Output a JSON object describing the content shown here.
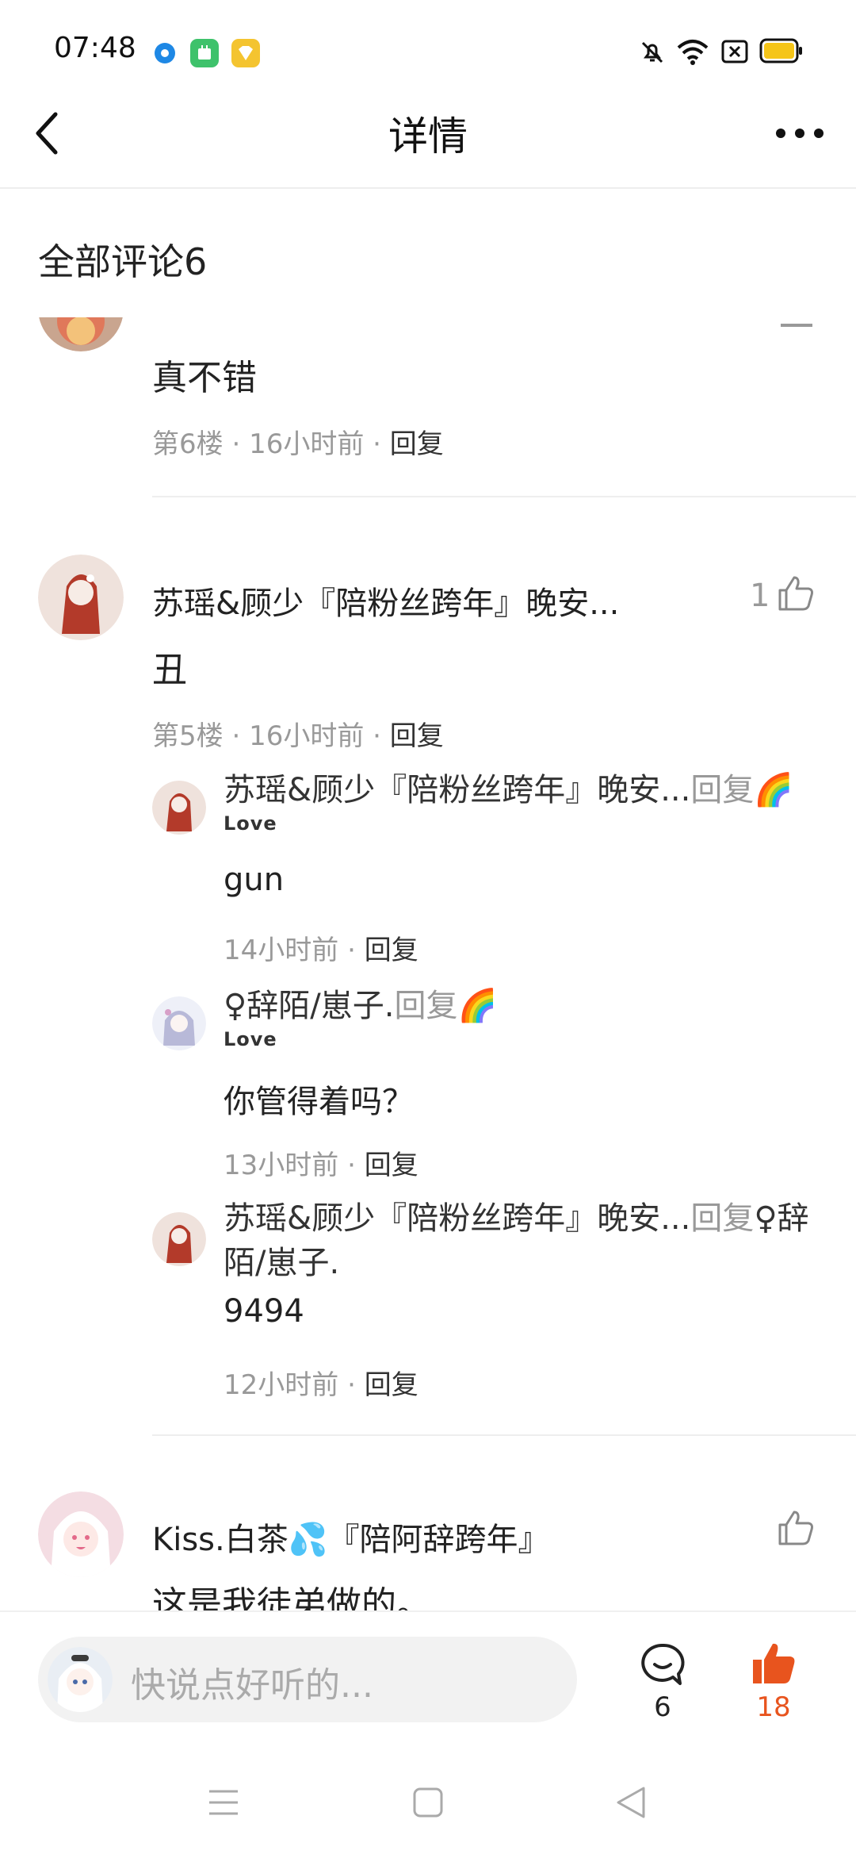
{
  "status_bar": {
    "time": "07:48"
  },
  "header": {
    "title": "详情"
  },
  "section": {
    "title": "全部评论6"
  },
  "comments": [
    {
      "body": "真不错",
      "floor": "第6楼",
      "time": "16小时前",
      "reply_label": "回复"
    },
    {
      "name": "苏瑶&顾少『陪粉丝跨年』晚安...",
      "likes": "1",
      "body": "丑",
      "floor": "第5楼",
      "time": "16小时前",
      "reply_label": "回复",
      "replies": [
        {
          "name": "苏瑶&顾少『陪粉丝跨年』晚安...",
          "reply_word": "回复",
          "target": "🌈",
          "badge": "Love",
          "body": "gun",
          "time": "14小时前",
          "reply_label": "回复"
        },
        {
          "name": "♀辞陌/崽子.",
          "reply_word": "回复",
          "target": "🌈",
          "badge": "Love",
          "body": "你管得着吗？",
          "time": "13小时前",
          "reply_label": "回复"
        },
        {
          "name": "苏瑶&顾少『陪粉丝跨年』晚安...",
          "reply_word": "回复",
          "target": "♀辞",
          "target_cont": "陌/崽子.",
          "body": "9494",
          "time": "12小时前",
          "reply_label": "回复"
        }
      ]
    },
    {
      "name": "Kiss.白茶💦『陪阿辞跨年』",
      "body": "这是我徒弟做的。"
    }
  ],
  "bottom_bar": {
    "input_placeholder": "快说点好听的...",
    "comment_count": "6",
    "like_count": "18"
  },
  "colors": {
    "accent": "#e8541e",
    "text_gray": "#999999"
  },
  "icons": [
    "back-arrow-icon",
    "more-dots-icon",
    "thumb-up-icon",
    "comment-bubble-icon",
    "thumb-up-filled-icon",
    "menu-nav-icon",
    "home-nav-icon",
    "back-nav-icon"
  ]
}
